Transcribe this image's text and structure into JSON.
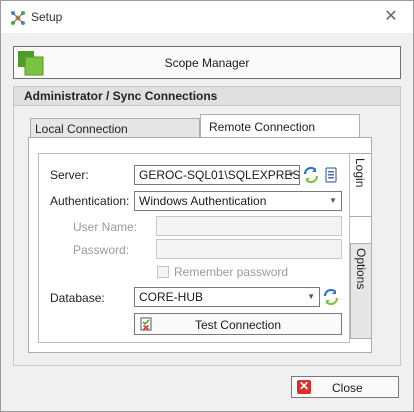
{
  "window": {
    "title": "Setup",
    "close_glyph": "✕"
  },
  "scope_manager": {
    "label": "Scope Manager",
    "icon": "scope-manager-icon"
  },
  "group": {
    "title": "Administrator / Sync Connections"
  },
  "tabs": [
    {
      "label": "Local Connection",
      "selected": false
    },
    {
      "label": "Remote Connection",
      "selected": true
    }
  ],
  "side_tabs": [
    {
      "label": "Login",
      "selected": true
    },
    {
      "label": "Options",
      "selected": false
    }
  ],
  "form": {
    "server_label": "Server:",
    "server_value": "GEROC-SQL01\\SQLEXPRES",
    "auth_label": "Authentication:",
    "auth_value": "Windows Authentication",
    "username_label": "User Name:",
    "username_value": "",
    "password_label": "Password:",
    "password_value": "",
    "remember_label": "Remember password",
    "remember_checked": false,
    "database_label": "Database:",
    "database_value": "CORE-HUB",
    "test_label": "Test Connection"
  },
  "footer": {
    "close_label": "Close"
  },
  "colors": {
    "accent_green": "#7bc142",
    "close_red": "#d9302c",
    "refresh_blue": "#2a73c7"
  }
}
